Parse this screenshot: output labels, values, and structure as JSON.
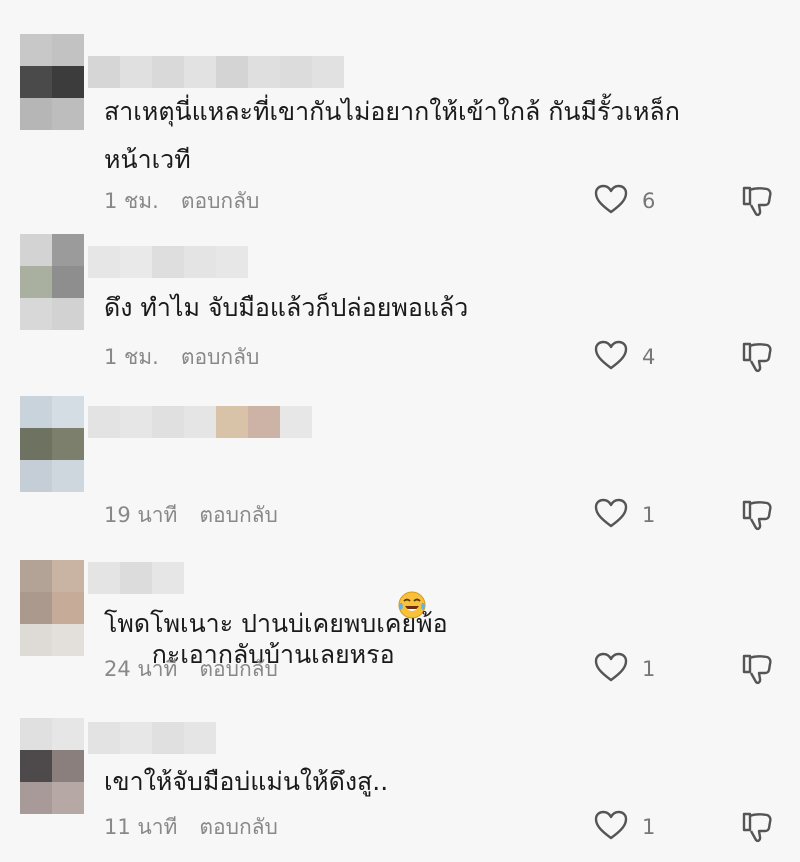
{
  "comments": [
    {
      "username_blurred": true,
      "text": "สาเหตุนี่แหละที่เขากันไม่อยากให้เข้าใกล้ กันมีรั้วเหล็กหน้าเวที",
      "time": "1 ชม.",
      "reply_label": "ตอบกลับ",
      "likes": "6",
      "avatar_colors": [
        "#c8c8c8",
        "#c2c2c2",
        "#4a4a4a",
        "#3c3c3c",
        "#b6b6b6",
        "#bdbdbd"
      ],
      "username_colors": [
        "#d6d6d6",
        "#e0e0e0",
        "#d9d9d9",
        "#e2e2e2",
        "#d4d4d4",
        "#dfdfdf",
        "#dcdcdc",
        "#e1e1e1"
      ]
    },
    {
      "username_blurred": true,
      "text": "ดึง ทำไม จับมือแล้วก็ปล่อยพอแล้ว",
      "time": "1 ชม.",
      "reply_label": "ตอบกลับ",
      "likes": "4",
      "avatar_colors": [
        "#d3d3d3",
        "#9b9b9b",
        "#a9b0a0",
        "#8e8e8e",
        "#d8d8d8",
        "#d2d2d2"
      ],
      "username_colors": [
        "#e6e6e6",
        "#e9e9e9",
        "#dedede",
        "#e4e4e4",
        "#e7e7e7"
      ]
    },
    {
      "username_blurred": true,
      "text": "กะเอากลับบ้านเลยหรอ",
      "time": "19 นาที",
      "reply_label": "ตอบกลับ",
      "likes": "1",
      "avatar_colors": [
        "#c9d3dc",
        "#d5dde4",
        "#6e7260",
        "#7b7f6c",
        "#c5ced6",
        "#cfd7de"
      ],
      "username_colors": [
        "#e3e3e3",
        "#e6e6e6",
        "#e0e0e0",
        "#e5e5e5",
        "#d8c3a8",
        "#cdb2a6",
        "#e7e7e7"
      ]
    },
    {
      "username_blurred": true,
      "text": "โพดโพเนาะ ปานบ่เคยพบเคยพ้อ",
      "time": "24 นาที",
      "reply_label": "ตอบกลับ",
      "likes": "1",
      "avatar_colors": [
        "#b3a396",
        "#c9b3a3",
        "#ab998d",
        "#c5ab98",
        "#dedad6",
        "#e3dfdb"
      ],
      "username_colors": [
        "#e4e4e4",
        "#dcdcdc",
        "#e6e6e6"
      ]
    },
    {
      "username_blurred": true,
      "text": "เขาให้จับมือบ่แม่นให้ดึงสู..",
      "time": "11 นาที",
      "reply_label": "ตอบกลับ",
      "likes": "1",
      "avatar_colors": [
        "#e0e0e0",
        "#e6e6e6",
        "#4e4a4b",
        "#8a7f7d",
        "#a89a98",
        "#b5a8a5"
      ],
      "username_colors": [
        "#e3e3e3",
        "#e7e7e7",
        "#e0e0e0",
        "#e5e5e5"
      ]
    }
  ],
  "icons": {
    "like": "heart-outline-icon",
    "dislike": "thumbs-down-outline-icon",
    "emoji": "tears-of-joy-emoji"
  },
  "colors": {
    "background": "#f7f7f7",
    "text": "#1a1a1a",
    "muted": "#888888",
    "icon": "#555555"
  }
}
